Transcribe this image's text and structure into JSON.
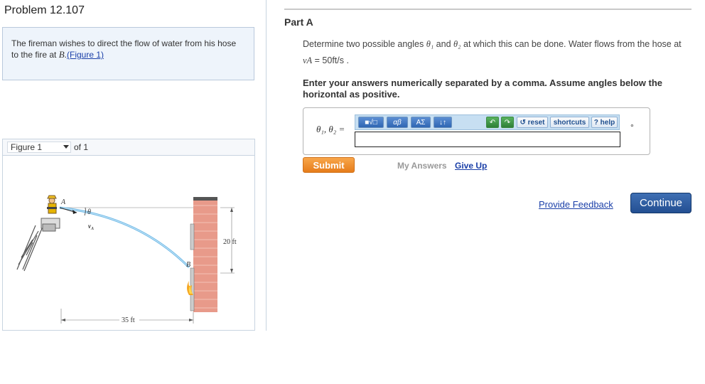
{
  "problem": {
    "title": "Problem 12.107",
    "statement_text": "The fireman wishes to direct the flow of water from his hose to the fire at ",
    "statement_point": "B",
    "figure_link": "(Figure 1)"
  },
  "figure_nav": {
    "selected": "Figure 1",
    "of_text": "of 1"
  },
  "figure": {
    "label_a": "A",
    "label_theta": "θ",
    "label_va": "v",
    "label_va_sub": "A",
    "label_b": "B",
    "height_label": "20 ft",
    "distance_label": "35 ft"
  },
  "part": {
    "label": "Part A",
    "question_1": "Determine two possible angles ",
    "theta1": "θ₁",
    "and_text": " and ",
    "theta2": "θ₂",
    "question_2": " at which this can be done. Water flows from the hose at ",
    "va_expr": "vA",
    "question_3": " = 50ft/s .",
    "instruction": "Enter your answers numerically separated by a comma. Assume angles below the horizontal as positive."
  },
  "answer": {
    "label": "θ₁, θ₂ =",
    "value": "",
    "unit": "°",
    "toolbar": {
      "templates": "■√□",
      "greek": "αβ",
      "symbols": "ΑΣ",
      "arrows": "↓↑",
      "undo": "↶",
      "redo": "↷",
      "reset": "↺ reset",
      "shortcuts": "shortcuts",
      "help": "? help"
    }
  },
  "actions": {
    "submit": "Submit",
    "my_answers": "My Answers",
    "give_up": "Give Up",
    "feedback": "Provide Feedback",
    "continue": "Continue"
  },
  "colors": {
    "link": "#1a3fa8",
    "submit": "#e88a2c",
    "continue": "#2f5c9e",
    "brick": "#e89a8a",
    "water": "#6bb7e6"
  }
}
